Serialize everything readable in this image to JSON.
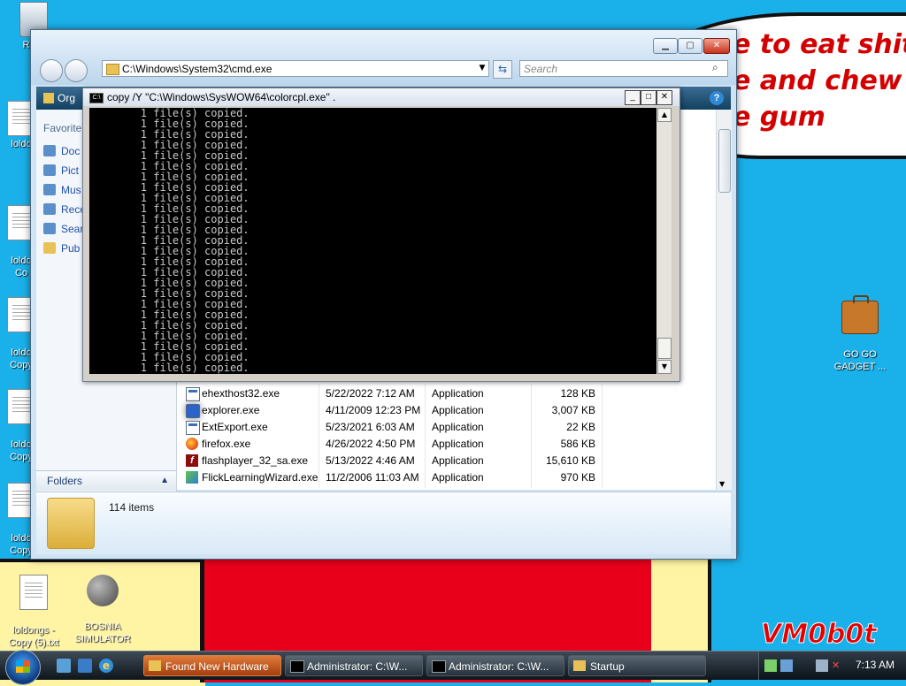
{
  "wallpaper": {
    "speech_lines": [
      "e to eat shit",
      "e and chew",
      "e gum"
    ],
    "watermark": "VM0b0t"
  },
  "desktop_icons": [
    {
      "label": "Recy",
      "type": "recycle"
    },
    {
      "label": "loldo",
      "type": "doc"
    },
    {
      "label": "loldo\nCo",
      "type": "doc"
    },
    {
      "label": "loldo\nCopy",
      "type": "doc"
    },
    {
      "label": "loldo\nCopy",
      "type": "doc"
    },
    {
      "label": "loldo\nCopy",
      "type": "doc"
    },
    {
      "label": "loldongs -\nCopy (5).txt",
      "type": "doc"
    },
    {
      "label": "BOSNIA\nSIMULATOR",
      "type": "mine"
    },
    {
      "label": "GO GO\nGADGET ...",
      "type": "briefcase"
    }
  ],
  "explorer": {
    "address": "C:\\Windows\\System32\\cmd.exe",
    "search_placeholder": "Search",
    "toolbar_organize": "Org",
    "nav": {
      "favorites": "Favorite",
      "items": [
        "Doc",
        "Pict",
        "Mus",
        "Rece",
        "Sear",
        "Pub"
      ],
      "folders_label": "Folders"
    },
    "files": [
      {
        "name": "ehexthost32.exe",
        "date": "5/22/2022 7:12 AM",
        "type": "Application",
        "size": "128 KB",
        "icon": "app"
      },
      {
        "name": "explorer.exe",
        "date": "4/11/2009 12:23 PM",
        "type": "Application",
        "size": "3,007 KB",
        "icon": "explorer"
      },
      {
        "name": "ExtExport.exe",
        "date": "5/23/2021 6:03 AM",
        "type": "Application",
        "size": "22 KB",
        "icon": "app"
      },
      {
        "name": "firefox.exe",
        "date": "4/26/2022 4:50 PM",
        "type": "Application",
        "size": "586 KB",
        "icon": "ff"
      },
      {
        "name": "flashplayer_32_sa.exe",
        "date": "5/13/2022 4:46 AM",
        "type": "Application",
        "size": "15,610 KB",
        "icon": "flash"
      },
      {
        "name": "FlickLearningWizard.exe",
        "date": "11/2/2006 11:03 AM",
        "type": "Application",
        "size": "970 KB",
        "icon": "wiz"
      }
    ],
    "status_items": "114 items"
  },
  "cmd": {
    "title": "copy  /Y \"C:\\Windows\\SysWOW64\\colorcpl.exe\" .",
    "line_text": "        1 file(s) copied.",
    "line_count": 25
  },
  "taskbar": {
    "buttons": [
      {
        "label": "Found New Hardware",
        "active": true
      },
      {
        "label": "Administrator: C:\\W...",
        "active": false
      },
      {
        "label": "Administrator: C:\\W...",
        "active": false
      },
      {
        "label": "Startup",
        "active": false
      }
    ],
    "clock": "7:13 AM"
  },
  "colors": {
    "desktop": "#1ab0ea",
    "accent_red": "#e8001b",
    "taskbar_active": "#c55a1c"
  }
}
